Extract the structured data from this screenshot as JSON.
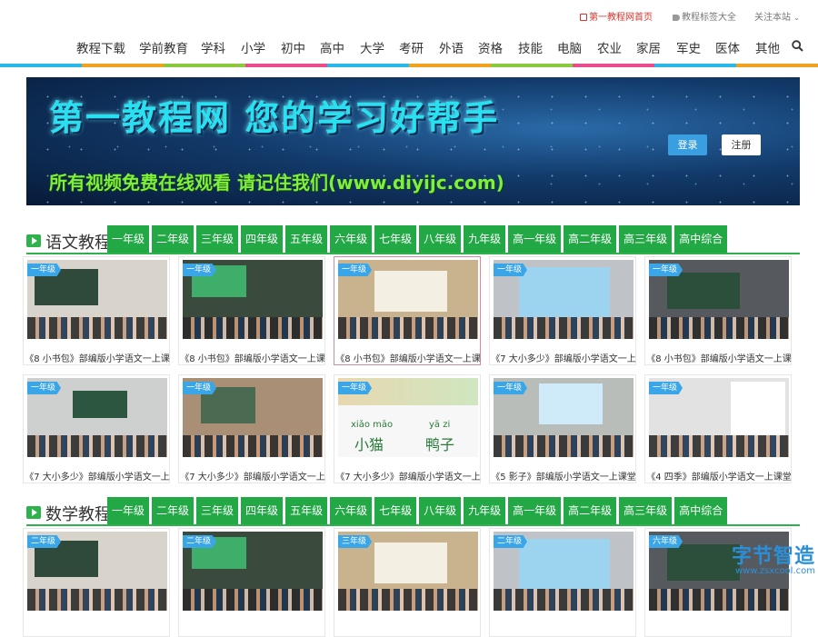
{
  "topbar": {
    "home_link": "第一教程网首页",
    "tags_link": "教程标签大全",
    "follow_link": "关注本站"
  },
  "nav": {
    "items": [
      "教程下载",
      "学前教育",
      "学科",
      "小学",
      "初中",
      "高中",
      "大学",
      "考研",
      "外语",
      "资格",
      "技能",
      "电脑",
      "农业",
      "家居",
      "军史",
      "医体",
      "其他"
    ]
  },
  "rainbow_colors": [
    "#2db7e8",
    "#f0a21e",
    "#8dc63f",
    "#e84c8a",
    "#2db7e8",
    "#f0a21e",
    "#8dc63f",
    "#e84c8a",
    "#2db7e8",
    "#f0a21e"
  ],
  "banner": {
    "title": "第一教程网  您的学习好帮手",
    "slogan": "所有视频免费在线观看    请记住我们(www.diyijc.com)",
    "login_label": "登录",
    "register_label": "注册"
  },
  "grades": [
    "一年级",
    "二年级",
    "三年级",
    "四年级",
    "五年级",
    "六年级",
    "七年级",
    "八年级",
    "九年级",
    "高一年级",
    "高二年级",
    "高三年级",
    "高中综合"
  ],
  "sections": [
    {
      "title": "语文教程"
    },
    {
      "title": "数学教程"
    }
  ],
  "chinese_videos": [
    {
      "badge": "一年级",
      "title": "《8 小书包》部编版小学语文一上课"
    },
    {
      "badge": "一年级",
      "title": "《8 小书包》部编版小学语文一上课"
    },
    {
      "badge": "一年级",
      "title": "《8 小书包》部编版小学语文一上课"
    },
    {
      "badge": "一年级",
      "title": "《7 大小多少》部编版小学语文一上"
    },
    {
      "badge": "一年级",
      "title": "《8 小书包》部编版小学语文一上课"
    },
    {
      "badge": "一年级",
      "title": "《7 大小多少》部编版小学语文一上"
    },
    {
      "badge": "一年级",
      "title": "《7 大小多少》部编版小学语文一上"
    },
    {
      "badge": "一年级",
      "title": "《7 大小多少》部编版小学语文一上"
    },
    {
      "badge": "一年级",
      "title": "《5 影子》部编版小学语文一上课堂"
    },
    {
      "badge": "一年级",
      "title": "《4 四季》部编版小学语文一上课堂"
    }
  ],
  "math_videos": [
    {
      "badge": "二年级"
    },
    {
      "badge": "二年级"
    },
    {
      "badge": "三年级"
    },
    {
      "badge": "二年级"
    },
    {
      "badge": "六年级"
    }
  ],
  "thumb_texts": {
    "pinyin_1": "xiǎo māo",
    "word_1": "小猫",
    "pinyin_2": "yā zi",
    "word_2": "鸭子"
  },
  "watermark": {
    "main": "字节智造",
    "sub": "www.zsxcool.com"
  }
}
